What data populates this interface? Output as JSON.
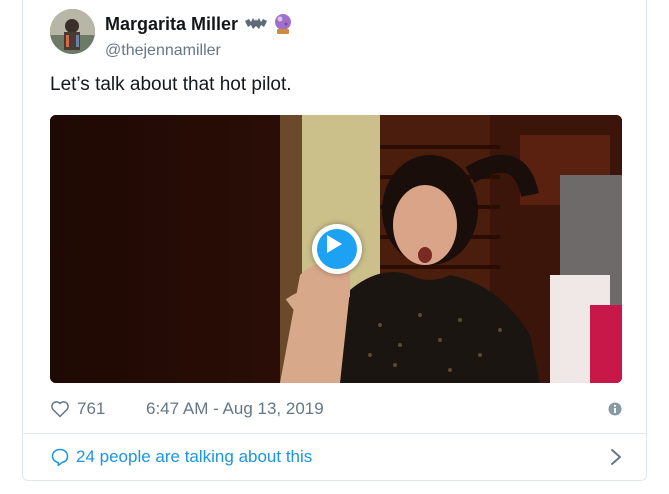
{
  "author": {
    "display_name": "Margarita Miller",
    "handle": "@thejennamiller",
    "emojis": [
      "bat-emoji",
      "crystal-ball-emoji"
    ]
  },
  "tweet": {
    "text": "Let’s talk about that hot pilot."
  },
  "media": {
    "type": "video",
    "play_icon": "play-icon"
  },
  "meta": {
    "like_count": "761",
    "timestamp": "6:47 AM - Aug 13, 2019"
  },
  "footer": {
    "talking_label": "24 people are talking about this"
  },
  "colors": {
    "accent": "#1da1f2",
    "link": "#1b95e0",
    "muted": "#657786",
    "border": "#e1e8ed"
  }
}
